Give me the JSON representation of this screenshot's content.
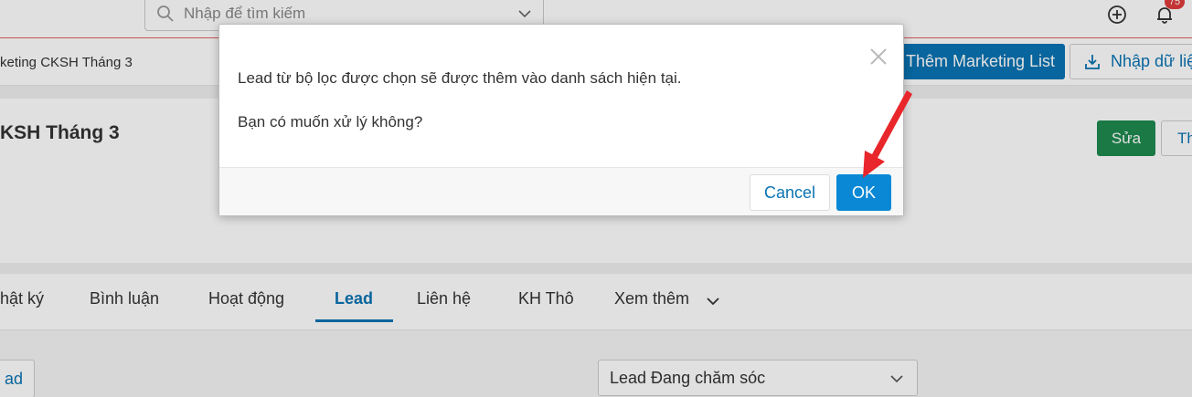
{
  "topbar": {
    "search_placeholder": "Nhập để tìm kiếm",
    "notification_count": "75"
  },
  "subbar": {
    "breadcrumb": "keting CKSH Tháng 3",
    "add_list_button": "Thêm Marketing List",
    "import_button": "Nhập dữ liệu"
  },
  "record": {
    "title": "KSH Tháng 3",
    "edit_button": "Sửa",
    "secondary_button": "Th"
  },
  "tabs": [
    {
      "label": "hật ký"
    },
    {
      "label": "Bình luận"
    },
    {
      "label": "Hoạt động"
    },
    {
      "label": "Lead"
    },
    {
      "label": "Liên hệ"
    },
    {
      "label": "KH Thô"
    },
    {
      "label": "Xem thêm"
    }
  ],
  "content": {
    "lead_button": "ad",
    "lead_filter_value": "Lead Đang chăm sóc"
  },
  "modal": {
    "message": "Lead từ bộ lọc được chọn sẽ được thêm vào danh sách hiện tại.",
    "question": "Bạn có muốn xử lý không?",
    "cancel_button": "Cancel",
    "ok_button": "OK"
  },
  "colors": {
    "primary": "#0a73b3",
    "ok_button": "#0a88d6",
    "edit_button": "#1e8a4f",
    "badge": "#e03c3c",
    "annotation_arrow": "#e8262b"
  }
}
